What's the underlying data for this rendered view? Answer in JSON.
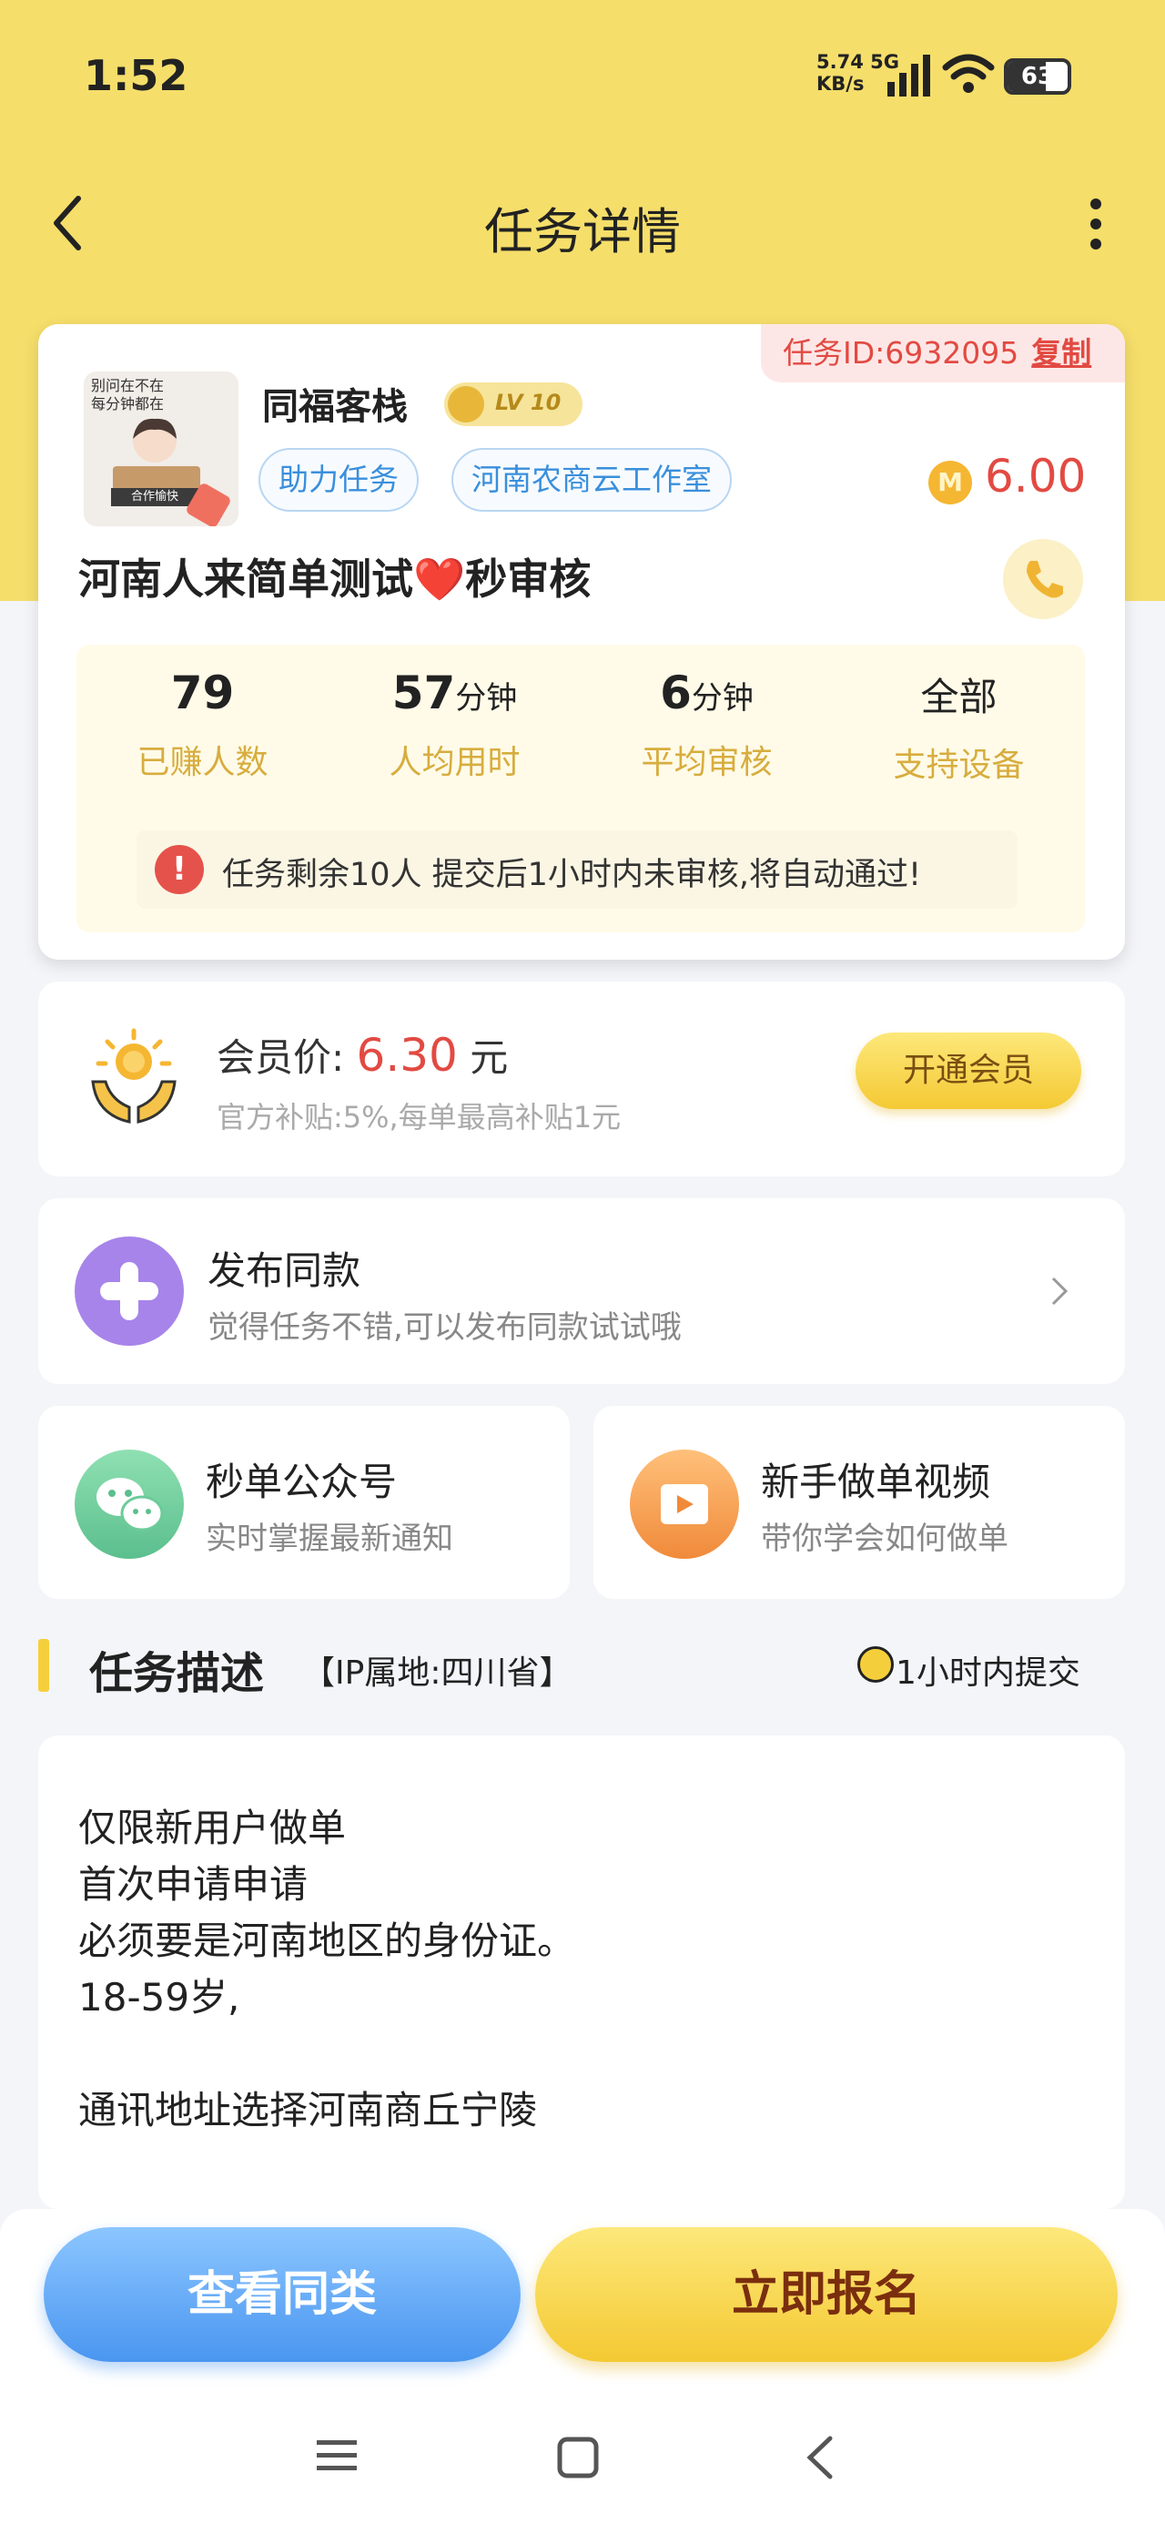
{
  "status": {
    "time": "1:52",
    "net_speed": "5.74",
    "net_unit": "KB/s",
    "net_type": "5G",
    "battery": "63"
  },
  "header": {
    "title": "任务详情"
  },
  "task": {
    "id_label": "任务ID:6932095",
    "copy_label": "复制",
    "avatar_text_1": "别问在不在",
    "avatar_text_2": "每分钟都在",
    "avatar_badge": "合作愉快",
    "shop_name": "同福客栈",
    "level": "LV 10",
    "tags": [
      "助力任务",
      "河南农商云工作室"
    ],
    "coin_icon": "M",
    "reward": "6.00",
    "title": "河南人来简单测试❤️秒审核",
    "stats": [
      {
        "value": "79",
        "unit": "",
        "label": "已赚人数"
      },
      {
        "value": "57",
        "unit": "分钟",
        "label": "人均用时"
      },
      {
        "value": "6",
        "unit": "分钟",
        "label": "平均审核"
      },
      {
        "value": "全部",
        "unit": "",
        "label": "支持设备"
      }
    ],
    "notice": "任务剩余10人  提交后1小时内未审核,将自动通过!"
  },
  "member": {
    "label": "会员价:",
    "price": "6.30",
    "unit": "元",
    "subsidy": "官方补贴:5%,每单最高补贴1元",
    "button": "开通会员"
  },
  "publish": {
    "title": "发布同款",
    "subtitle": "觉得任务不错,可以发布同款试试哦"
  },
  "wechat": {
    "title": "秒单公众号",
    "subtitle": "实时掌握最新通知"
  },
  "video": {
    "title": "新手做单视频",
    "subtitle": "带你学会如何做单"
  },
  "description": {
    "heading": "任务描述",
    "ip": "【IP属地:四川省】",
    "deadline": "1小时内提交",
    "lines": [
      "仅限新用户做单",
      "首次申请申请",
      "必须要是河南地区的身份证。",
      "18-59岁,",
      "",
      "通讯地址选择河南商丘宁陵"
    ]
  },
  "actions": {
    "view_similar": "查看同类",
    "apply_now": "立即报名"
  },
  "colors": {
    "header_bg": "#f5de6a",
    "accent_red": "#e24a42",
    "accent_yellow": "#f4c933",
    "tag_blue": "#3a8fdc"
  }
}
